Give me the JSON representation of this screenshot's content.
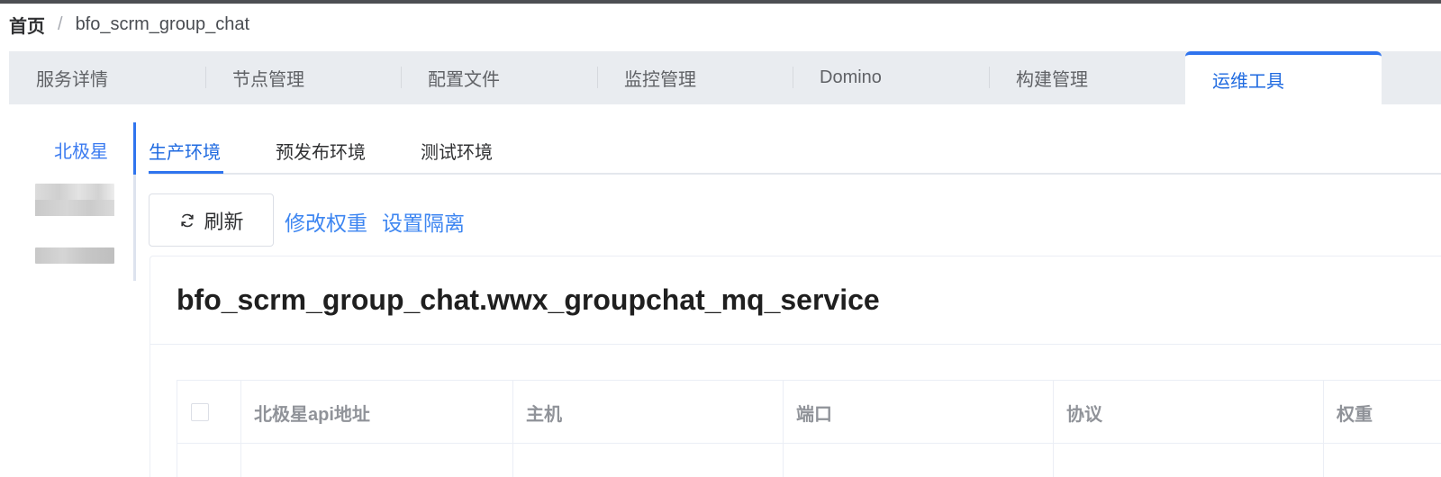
{
  "breadcrumb": {
    "home": "首页",
    "separator": "/",
    "current": "bfo_scrm_group_chat"
  },
  "tabs": [
    {
      "label": "服务详情"
    },
    {
      "label": "节点管理"
    },
    {
      "label": "配置文件"
    },
    {
      "label": "监控管理"
    },
    {
      "label": "Domino"
    },
    {
      "label": "构建管理"
    },
    {
      "label": "运维工具",
      "active": true
    }
  ],
  "side_nav": {
    "active_item": "北极星"
  },
  "env_tabs": [
    {
      "label": "生产环境",
      "active": true
    },
    {
      "label": "预发布环境"
    },
    {
      "label": "测试环境"
    }
  ],
  "toolbar": {
    "refresh_label": "刷新",
    "modify_weight_label": "修改权重",
    "set_isolation_label": "设置隔离"
  },
  "service": {
    "name": "bfo_scrm_group_chat.wwx_groupchat_mq_service"
  },
  "table": {
    "columns": [
      "北极星api地址",
      "主机",
      "端口",
      "协议",
      "权重"
    ]
  },
  "colors": {
    "accent": "#2f74ee",
    "link": "#3e86f1",
    "tab_bar_bg": "#e9ecf0",
    "header_text": "#909399"
  }
}
